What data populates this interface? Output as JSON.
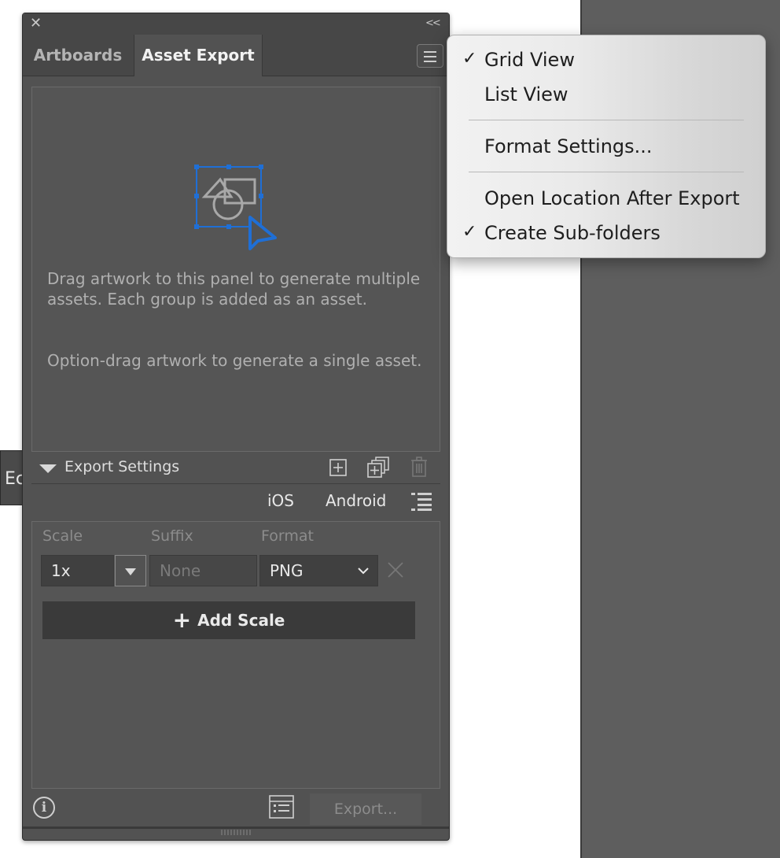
{
  "panel": {
    "tabs": [
      {
        "label": "Artboards"
      },
      {
        "label": "Asset Export"
      }
    ],
    "drop_text_1": "Drag artwork to this panel to generate multiple assets. Each group is added as an asset.",
    "drop_text_2": "Option-drag artwork to generate a single asset.",
    "export_settings_label": "Export Settings",
    "platform_ios": "iOS",
    "platform_android": "Android",
    "columns": {
      "scale": "Scale",
      "suffix": "Suffix",
      "format": "Format"
    },
    "scale_value": "1x",
    "suffix_placeholder": "None",
    "format_value": "PNG",
    "add_scale_label": "Add Scale",
    "export_button": "Export..."
  },
  "behind_panel_text": "Ec",
  "menu": {
    "items": [
      {
        "label": "Grid View",
        "checked": true
      },
      {
        "label": "List View",
        "checked": false
      },
      {
        "label": "Format Settings...",
        "checked": false
      },
      {
        "label": "Open Location After Export",
        "checked": false
      },
      {
        "label": "Create Sub-folders",
        "checked": true
      }
    ],
    "check_glyph": "✓"
  },
  "colors": {
    "selection_blue": "#1f6fd6",
    "panel_bg": "#525252",
    "menu_bg": "#ececec"
  }
}
